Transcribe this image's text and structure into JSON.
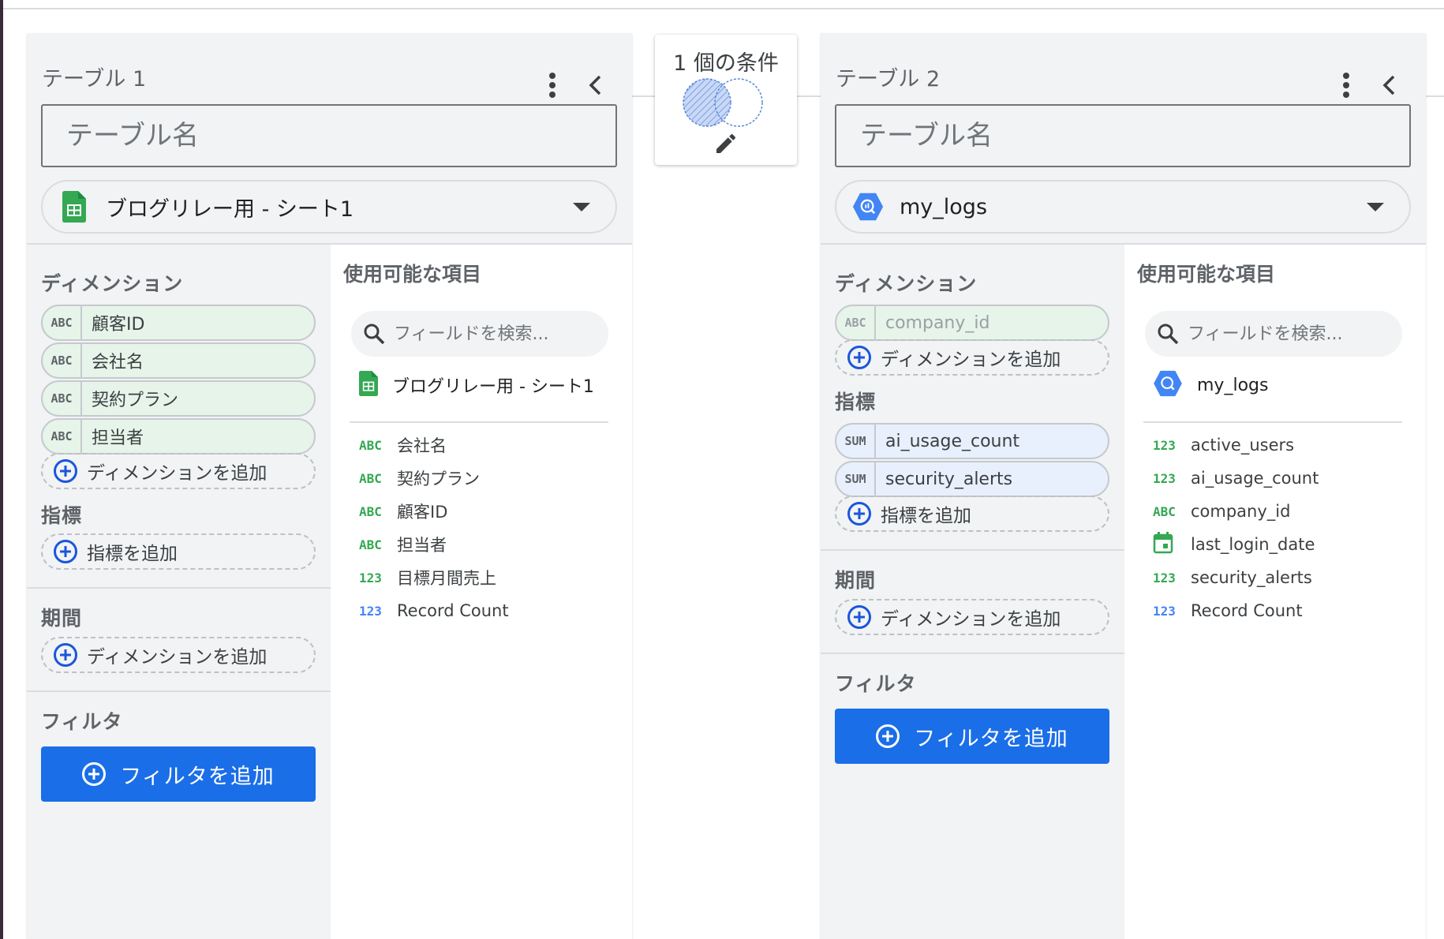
{
  "join": {
    "condition_label": "1 個の条件"
  },
  "common": {
    "table_name_placeholder": "テーブル名",
    "dimensions_heading": "ディメンション",
    "metrics_heading": "指標",
    "date_range_heading": "期間",
    "filter_heading": "フィルタ",
    "add_dimension": "ディメンションを追加",
    "add_metric": "指標を追加",
    "add_filter": "フィルタを追加",
    "available_fields": "使用可能な項目",
    "search_placeholder": "フィールドを検索..."
  },
  "table1": {
    "title": "テーブル 1",
    "source_name": "ブログリレー用 - シート1",
    "source_icon": "google-sheets-icon",
    "dimensions": [
      {
        "type": "ABC",
        "label": "顧客ID"
      },
      {
        "type": "ABC",
        "label": "会社名"
      },
      {
        "type": "ABC",
        "label": "契約プラン"
      },
      {
        "type": "ABC",
        "label": "担当者"
      }
    ],
    "fields": [
      {
        "type": "ABC",
        "label": "会社名"
      },
      {
        "type": "ABC",
        "label": "契約プラン"
      },
      {
        "type": "ABC",
        "label": "顧客ID"
      },
      {
        "type": "ABC",
        "label": "担当者"
      },
      {
        "type": "123",
        "label": "目標月間売上"
      },
      {
        "type": "123",
        "label": "Record Count"
      }
    ]
  },
  "table2": {
    "title": "テーブル 2",
    "source_name": "my_logs",
    "source_icon": "bigquery-icon",
    "dimensions": [
      {
        "type": "ABC",
        "label": "company_id"
      }
    ],
    "metrics": [
      {
        "type": "SUM",
        "label": "ai_usage_count"
      },
      {
        "type": "SUM",
        "label": "security_alerts"
      }
    ],
    "fields": [
      {
        "type": "123",
        "label": "active_users"
      },
      {
        "type": "123",
        "label": "ai_usage_count"
      },
      {
        "type": "ABC",
        "label": "company_id"
      },
      {
        "type": "calendar-icon",
        "label": "last_login_date"
      },
      {
        "type": "123",
        "label": "security_alerts"
      },
      {
        "type": "123",
        "label": "Record Count"
      }
    ]
  },
  "colors": {
    "accent": "#1a6ee8",
    "dimension_chip": "#e6f4ea",
    "metric_chip": "#e8f0fe",
    "panel_bg": "#f1f3f4",
    "field_type_green": "#34a853",
    "field_type_blue": "#4285f4"
  }
}
